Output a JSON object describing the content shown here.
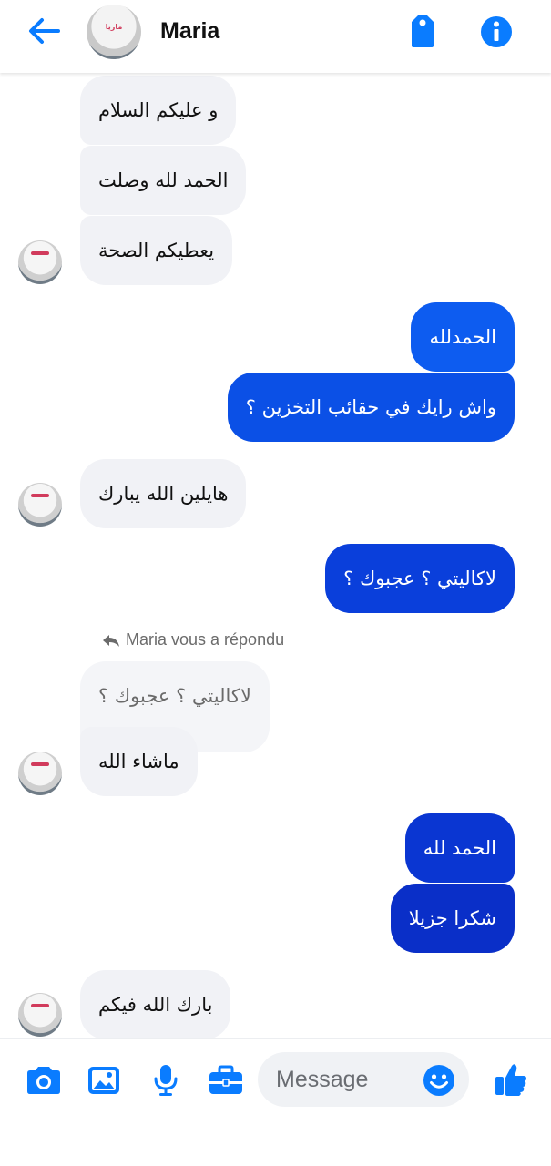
{
  "header": {
    "contact_name": "Maria",
    "avatar_caption": "ماريا",
    "back_icon": "arrow-left-icon",
    "tag_icon": "tag-icon",
    "info_icon": "info-icon"
  },
  "colors": {
    "accent": "#0a7cff",
    "incoming_bubble": "#f1f2f6",
    "outgoing_top": "#0d5cf0",
    "outgoing_bottom": "#0a2fc8"
  },
  "messages": [
    {
      "side": "in",
      "text": "و عليكم السلام"
    },
    {
      "side": "in",
      "text": "الحمد لله وصلت"
    },
    {
      "side": "in",
      "text": "يعطيكم الصحة"
    },
    {
      "side": "out",
      "text": "الحمدلله"
    },
    {
      "side": "out",
      "text": "واش رايك في حقائب التخزين ؟"
    },
    {
      "side": "in",
      "text": "هايلين الله يبارك"
    },
    {
      "side": "out",
      "text": "لاكاليتي ؟ عجبوك ؟"
    },
    {
      "side": "quote",
      "text": "لاكاليتي ؟ عجبوك ؟"
    },
    {
      "side": "in",
      "text": "ماشاء الله"
    },
    {
      "side": "out",
      "text": "الحمد لله"
    },
    {
      "side": "out",
      "text": "شكرا جزيلا"
    },
    {
      "side": "in",
      "text": "بارك الله فيكم"
    }
  ],
  "reply_note": "Maria vous a répondu",
  "composer": {
    "placeholder": "Message",
    "icons": [
      "camera-icon",
      "image-icon",
      "microphone-icon",
      "briefcase-icon",
      "emoji-icon",
      "thumbs-up-icon"
    ]
  }
}
